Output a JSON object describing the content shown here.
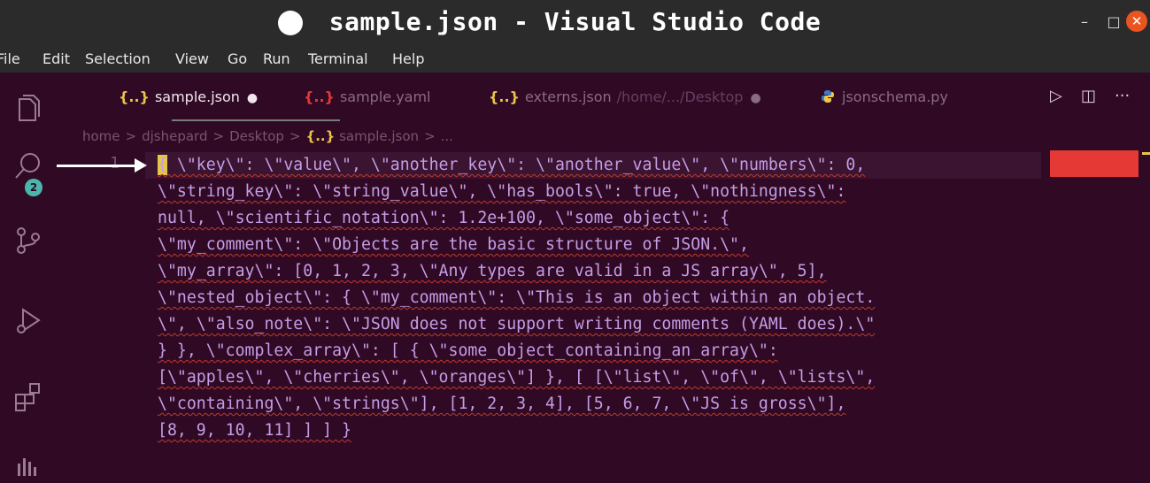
{
  "window": {
    "title": "sample.json - Visual Studio Code",
    "controls": {
      "minimize": "–",
      "maximize": "□",
      "close": "✕"
    }
  },
  "menu": [
    "File",
    "Edit",
    "Selection",
    "View",
    "Go",
    "Run",
    "Terminal",
    "Help"
  ],
  "activity_bar": {
    "icons": [
      "explorer-icon",
      "search-icon",
      "source-control-icon",
      "run-debug-icon",
      "extensions-icon",
      "outline-icon"
    ],
    "explorer_badge": "2"
  },
  "tabs": [
    {
      "icon": "{..}",
      "name": "sample.json",
      "extra": "",
      "modified": true,
      "active": true
    },
    {
      "icon": "{..}",
      "name": "sample.yaml",
      "extra": "",
      "modified": false,
      "active": false
    },
    {
      "icon": "{..}",
      "name": "externs.json",
      "extra": "/home/.../Desktop",
      "modified": true,
      "active": false
    },
    {
      "icon": "python-icon",
      "name": "jsonschema.py",
      "extra": "",
      "modified": false,
      "active": false
    }
  ],
  "tab_actions": {
    "run": "▷",
    "split": "◫",
    "more": "···"
  },
  "breadcrumb": [
    "home",
    "djshepard",
    "Desktop",
    "sample.json",
    "..."
  ],
  "breadcrumb_icon": "{..}",
  "editor": {
    "line_number": "1",
    "code_lines": [
      "{ \\\"key\\\": \\\"value\\\", \\\"another_key\\\": \\\"another_value\\\", \\\"numbers\\\": 0,",
      "\\\"string_key\\\": \\\"string_value\\\", \\\"has_bools\\\": true, \\\"nothingness\\\":",
      "null, \\\"scientific_notation\\\": 1.2e+100, \\\"some_object\\\": {",
      "\\\"my_comment\\\": \\\"Objects are the basic structure of JSON.\\\",",
      "\\\"my_array\\\": [0, 1, 2, 3, \\\"Any types are valid in a JS array\\\", 5],",
      "\\\"nested_object\\\": { \\\"my_comment\\\": \\\"This is an object within an object.",
      "\\\", \\\"also_note\\\": \\\"JSON does not support writing comments (YAML does).\\\"",
      "} }, \\\"complex_array\\\": [ { \\\"some_object_containing_an_array\\\":",
      "[\\\"apples\\\", \\\"cherries\\\", \\\"oranges\\\"] }, [ [\\\"list\\\", \\\"of\\\", \\\"lists\\\",",
      "\\\"containing\\\", \\\"strings\\\"], [1, 2, 3, 4], [5, 6, 7, \\\"JS is gross\\\"],",
      "[8, 9, 10, 11] ] ] }"
    ]
  },
  "colors": {
    "editor_bg": "#300a24",
    "titlebar_bg": "#2b2b2b",
    "code_text": "#c39ee6",
    "json_icon": "#e7c547",
    "error": "#e53935",
    "close_button": "#e95420"
  }
}
